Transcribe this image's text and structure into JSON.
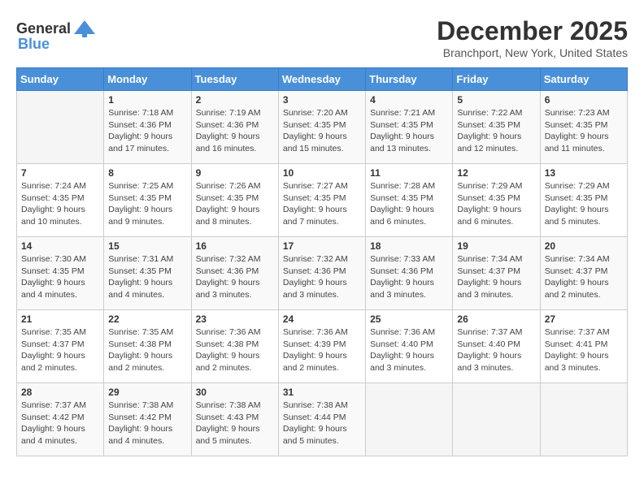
{
  "header": {
    "logo_general": "General",
    "logo_blue": "Blue",
    "title": "December 2025",
    "location": "Branchport, New York, United States"
  },
  "calendar": {
    "days_of_week": [
      "Sunday",
      "Monday",
      "Tuesday",
      "Wednesday",
      "Thursday",
      "Friday",
      "Saturday"
    ],
    "weeks": [
      [
        {
          "day": "",
          "sunrise": "",
          "sunset": "",
          "daylight": ""
        },
        {
          "day": "1",
          "sunrise": "Sunrise: 7:18 AM",
          "sunset": "Sunset: 4:36 PM",
          "daylight": "Daylight: 9 hours and 17 minutes."
        },
        {
          "day": "2",
          "sunrise": "Sunrise: 7:19 AM",
          "sunset": "Sunset: 4:36 PM",
          "daylight": "Daylight: 9 hours and 16 minutes."
        },
        {
          "day": "3",
          "sunrise": "Sunrise: 7:20 AM",
          "sunset": "Sunset: 4:35 PM",
          "daylight": "Daylight: 9 hours and 15 minutes."
        },
        {
          "day": "4",
          "sunrise": "Sunrise: 7:21 AM",
          "sunset": "Sunset: 4:35 PM",
          "daylight": "Daylight: 9 hours and 13 minutes."
        },
        {
          "day": "5",
          "sunrise": "Sunrise: 7:22 AM",
          "sunset": "Sunset: 4:35 PM",
          "daylight": "Daylight: 9 hours and 12 minutes."
        },
        {
          "day": "6",
          "sunrise": "Sunrise: 7:23 AM",
          "sunset": "Sunset: 4:35 PM",
          "daylight": "Daylight: 9 hours and 11 minutes."
        }
      ],
      [
        {
          "day": "7",
          "sunrise": "Sunrise: 7:24 AM",
          "sunset": "Sunset: 4:35 PM",
          "daylight": "Daylight: 9 hours and 10 minutes."
        },
        {
          "day": "8",
          "sunrise": "Sunrise: 7:25 AM",
          "sunset": "Sunset: 4:35 PM",
          "daylight": "Daylight: 9 hours and 9 minutes."
        },
        {
          "day": "9",
          "sunrise": "Sunrise: 7:26 AM",
          "sunset": "Sunset: 4:35 PM",
          "daylight": "Daylight: 9 hours and 8 minutes."
        },
        {
          "day": "10",
          "sunrise": "Sunrise: 7:27 AM",
          "sunset": "Sunset: 4:35 PM",
          "daylight": "Daylight: 9 hours and 7 minutes."
        },
        {
          "day": "11",
          "sunrise": "Sunrise: 7:28 AM",
          "sunset": "Sunset: 4:35 PM",
          "daylight": "Daylight: 9 hours and 6 minutes."
        },
        {
          "day": "12",
          "sunrise": "Sunrise: 7:29 AM",
          "sunset": "Sunset: 4:35 PM",
          "daylight": "Daylight: 9 hours and 6 minutes."
        },
        {
          "day": "13",
          "sunrise": "Sunrise: 7:29 AM",
          "sunset": "Sunset: 4:35 PM",
          "daylight": "Daylight: 9 hours and 5 minutes."
        }
      ],
      [
        {
          "day": "14",
          "sunrise": "Sunrise: 7:30 AM",
          "sunset": "Sunset: 4:35 PM",
          "daylight": "Daylight: 9 hours and 4 minutes."
        },
        {
          "day": "15",
          "sunrise": "Sunrise: 7:31 AM",
          "sunset": "Sunset: 4:35 PM",
          "daylight": "Daylight: 9 hours and 4 minutes."
        },
        {
          "day": "16",
          "sunrise": "Sunrise: 7:32 AM",
          "sunset": "Sunset: 4:36 PM",
          "daylight": "Daylight: 9 hours and 3 minutes."
        },
        {
          "day": "17",
          "sunrise": "Sunrise: 7:32 AM",
          "sunset": "Sunset: 4:36 PM",
          "daylight": "Daylight: 9 hours and 3 minutes."
        },
        {
          "day": "18",
          "sunrise": "Sunrise: 7:33 AM",
          "sunset": "Sunset: 4:36 PM",
          "daylight": "Daylight: 9 hours and 3 minutes."
        },
        {
          "day": "19",
          "sunrise": "Sunrise: 7:34 AM",
          "sunset": "Sunset: 4:37 PM",
          "daylight": "Daylight: 9 hours and 3 minutes."
        },
        {
          "day": "20",
          "sunrise": "Sunrise: 7:34 AM",
          "sunset": "Sunset: 4:37 PM",
          "daylight": "Daylight: 9 hours and 2 minutes."
        }
      ],
      [
        {
          "day": "21",
          "sunrise": "Sunrise: 7:35 AM",
          "sunset": "Sunset: 4:37 PM",
          "daylight": "Daylight: 9 hours and 2 minutes."
        },
        {
          "day": "22",
          "sunrise": "Sunrise: 7:35 AM",
          "sunset": "Sunset: 4:38 PM",
          "daylight": "Daylight: 9 hours and 2 minutes."
        },
        {
          "day": "23",
          "sunrise": "Sunrise: 7:36 AM",
          "sunset": "Sunset: 4:38 PM",
          "daylight": "Daylight: 9 hours and 2 minutes."
        },
        {
          "day": "24",
          "sunrise": "Sunrise: 7:36 AM",
          "sunset": "Sunset: 4:39 PM",
          "daylight": "Daylight: 9 hours and 2 minutes."
        },
        {
          "day": "25",
          "sunrise": "Sunrise: 7:36 AM",
          "sunset": "Sunset: 4:40 PM",
          "daylight": "Daylight: 9 hours and 3 minutes."
        },
        {
          "day": "26",
          "sunrise": "Sunrise: 7:37 AM",
          "sunset": "Sunset: 4:40 PM",
          "daylight": "Daylight: 9 hours and 3 minutes."
        },
        {
          "day": "27",
          "sunrise": "Sunrise: 7:37 AM",
          "sunset": "Sunset: 4:41 PM",
          "daylight": "Daylight: 9 hours and 3 minutes."
        }
      ],
      [
        {
          "day": "28",
          "sunrise": "Sunrise: 7:37 AM",
          "sunset": "Sunset: 4:42 PM",
          "daylight": "Daylight: 9 hours and 4 minutes."
        },
        {
          "day": "29",
          "sunrise": "Sunrise: 7:38 AM",
          "sunset": "Sunset: 4:42 PM",
          "daylight": "Daylight: 9 hours and 4 minutes."
        },
        {
          "day": "30",
          "sunrise": "Sunrise: 7:38 AM",
          "sunset": "Sunset: 4:43 PM",
          "daylight": "Daylight: 9 hours and 5 minutes."
        },
        {
          "day": "31",
          "sunrise": "Sunrise: 7:38 AM",
          "sunset": "Sunset: 4:44 PM",
          "daylight": "Daylight: 9 hours and 5 minutes."
        },
        {
          "day": "",
          "sunrise": "",
          "sunset": "",
          "daylight": ""
        },
        {
          "day": "",
          "sunrise": "",
          "sunset": "",
          "daylight": ""
        },
        {
          "day": "",
          "sunrise": "",
          "sunset": "",
          "daylight": ""
        }
      ]
    ]
  }
}
